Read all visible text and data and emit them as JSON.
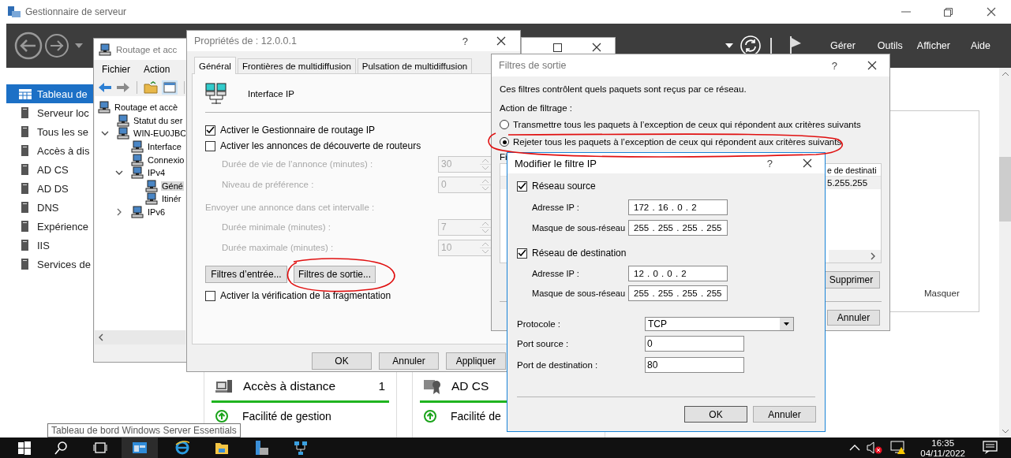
{
  "server_manager": {
    "title": "Gestionnaire de serveur",
    "menu": [
      "Gérer",
      "Outils",
      "Afficher",
      "Aide"
    ]
  },
  "sidebar": {
    "items": [
      {
        "label": "Tableau de",
        "selected": true
      },
      {
        "label": "Serveur loc",
        "selected": false
      },
      {
        "label": "Tous les se",
        "selected": false
      },
      {
        "label": "Accès à dis",
        "selected": false
      },
      {
        "label": "AD CS",
        "selected": false
      },
      {
        "label": "AD DS",
        "selected": false
      },
      {
        "label": "DNS",
        "selected": false
      },
      {
        "label": "Expérience",
        "selected": false
      },
      {
        "label": "IIS",
        "selected": false
      },
      {
        "label": "Services de",
        "selected": false
      }
    ]
  },
  "side_panel": {
    "link": "Masquer"
  },
  "tiles": [
    {
      "title": "Accès à distance",
      "count": "1",
      "status": "Facilité de gestion"
    },
    {
      "title": "AD CS",
      "status": "Facilité de"
    }
  ],
  "routing_window": {
    "title": "Routage et acc",
    "menu": [
      "Fichier",
      "Action"
    ],
    "tree": [
      {
        "label": "Routage et accè",
        "selected": false,
        "children": [
          {
            "label": "Statut du ser",
            "selected": false
          },
          {
            "label": "WIN-EU0JBC",
            "selected": false,
            "expanded": true,
            "children": [
              {
                "label": "Interface",
                "selected": false
              },
              {
                "label": "Connexio",
                "selected": false
              },
              {
                "label": "IPv4",
                "selected": false,
                "expanded": true,
                "children": [
                  {
                    "label": "Géné",
                    "selected": true
                  },
                  {
                    "label": "Itinér",
                    "selected": false
                  }
                ]
              },
              {
                "label": "IPv6",
                "selected": false,
                "expanded": false
              }
            ]
          }
        ]
      }
    ]
  },
  "properties_dialog": {
    "title": "Propriétés de : 12.0.0.1",
    "help": "?",
    "tabs": [
      {
        "label": "Général",
        "selected": true
      },
      {
        "label": "Frontières de multidiffusion",
        "selected": false
      },
      {
        "label": "Pulsation de multidiffusion",
        "selected": false
      }
    ],
    "header": "Interface IP",
    "checks": [
      {
        "label": "Activer le Gestionnaire de routage IP",
        "checked": true
      },
      {
        "label": "Activer les annonces de découverte de routeurs",
        "checked": false
      }
    ],
    "settings": [
      {
        "kind": "spin",
        "label": "Durée de vie de l’annonce (minutes) :",
        "value": "30",
        "disabled": true
      },
      {
        "kind": "spin",
        "label": "Niveau de préférence :",
        "value": "0",
        "disabled": true
      },
      {
        "kind": "heading",
        "label": "Envoyer une annonce dans cet intervalle :",
        "disabled": true
      },
      {
        "kind": "spin",
        "label": "Durée minimale (minutes) :",
        "value": "7",
        "disabled": true
      },
      {
        "kind": "spin",
        "label": "Durée maximale (minutes) :",
        "value": "10",
        "disabled": true
      }
    ],
    "filter_buttons": [
      "Filtres d’entrée...",
      "Filtres de sortie..."
    ],
    "fragmentation": {
      "label": "Activer la vérification de la fragmentation",
      "checked": false
    },
    "buttons": [
      "OK",
      "Annuler",
      "Appliquer"
    ]
  },
  "output_filters_dialog": {
    "title": "Filtres de sortie",
    "help": "?",
    "description": "Ces filtres contrôlent quels paquets sont reçus par ce réseau.",
    "action_label": "Action de filtrage :",
    "actions": [
      {
        "label": "Transmettre tous les paquets à l’exception de ceux qui répondent aux critères suivants",
        "selected": false
      },
      {
        "label": "Rejeter tous les paquets à l’exception de ceux qui répondent aux critères suivants",
        "selected": true
      }
    ],
    "list_label": "Fi",
    "columns": [
      "e de destinati"
    ],
    "rows": [
      [
        "5.255.255"
      ]
    ],
    "buttons": [
      "Supprimer",
      "Annuler"
    ]
  },
  "edit_filter_dialog": {
    "title": "Modifier le filtre IP",
    "help": "?",
    "networks": [
      {
        "label": "Réseau source",
        "checked": true,
        "address_label": "Adresse IP :",
        "address": "172 . 16 . 0 . 2",
        "mask_label": "Masque de sous-réseau",
        "mask": "255 . 255 . 255 . 255"
      },
      {
        "label": "Réseau de destination",
        "checked": true,
        "address_label": "Adresse IP :",
        "address": "12 . 0 . 0 . 2",
        "mask_label": "Masque de sous-réseau",
        "mask": "255 . 255 . 255 . 255"
      }
    ],
    "protocol": {
      "label": "Protocole :",
      "value": "TCP"
    },
    "ports": [
      {
        "label": "Port source :",
        "value": "0"
      },
      {
        "label": "Port de destination :",
        "value": "80"
      }
    ],
    "buttons": [
      "OK",
      "Annuler"
    ]
  },
  "tooltip": "Tableau de bord Windows Server Essentials",
  "taskbar": {
    "time": "16:35",
    "date": "04/11/2022"
  }
}
